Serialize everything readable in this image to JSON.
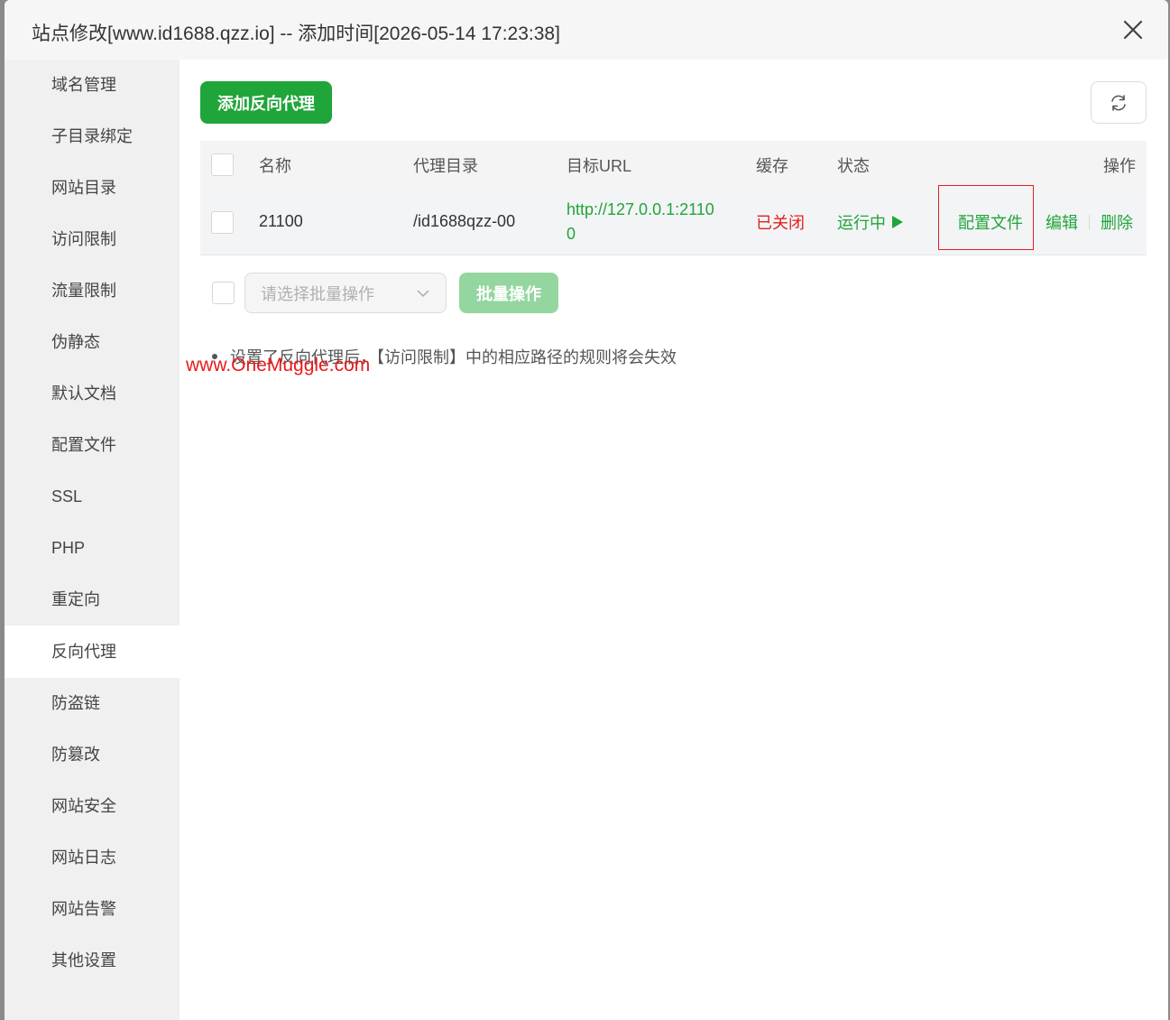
{
  "dialog": {
    "title": "站点修改[www.id1688.qzz.io] -- 添加时间[2026-05-14 17:23:38]"
  },
  "sidebar": {
    "items": [
      {
        "label": "域名管理"
      },
      {
        "label": "子目录绑定"
      },
      {
        "label": "网站目录"
      },
      {
        "label": "访问限制"
      },
      {
        "label": "流量限制"
      },
      {
        "label": "伪静态"
      },
      {
        "label": "默认文档"
      },
      {
        "label": "配置文件"
      },
      {
        "label": "SSL"
      },
      {
        "label": "PHP"
      },
      {
        "label": "重定向"
      },
      {
        "label": "反向代理"
      },
      {
        "label": "防盗链"
      },
      {
        "label": "防篡改"
      },
      {
        "label": "网站安全"
      },
      {
        "label": "网站日志"
      },
      {
        "label": "网站告警"
      },
      {
        "label": "其他设置"
      }
    ],
    "active": "反向代理"
  },
  "toolbar": {
    "add_label": "添加反向代理"
  },
  "table": {
    "headers": {
      "name": "名称",
      "dir": "代理目录",
      "url": "目标URL",
      "cache": "缓存",
      "status": "状态",
      "actions": "操作"
    },
    "rows": [
      {
        "name": "21100",
        "dir": "/id1688qzz-00",
        "url_line1": "http://127.0.0.1:2110",
        "url_line2": "0",
        "cache": "已关闭",
        "status": "运行中",
        "action_config": "配置文件",
        "action_edit": "编辑",
        "action_delete": "删除"
      }
    ]
  },
  "batch": {
    "placeholder": "请选择批量操作",
    "button": "批量操作"
  },
  "tips": [
    "设置了反向代理后，【访问限制】中的相应路径的规则将会失效"
  ],
  "watermark": "www.OneMuggle.com",
  "colors": {
    "accent": "#20a53a",
    "danger": "#e02020",
    "sidebar_bg": "#f0f0f0"
  }
}
